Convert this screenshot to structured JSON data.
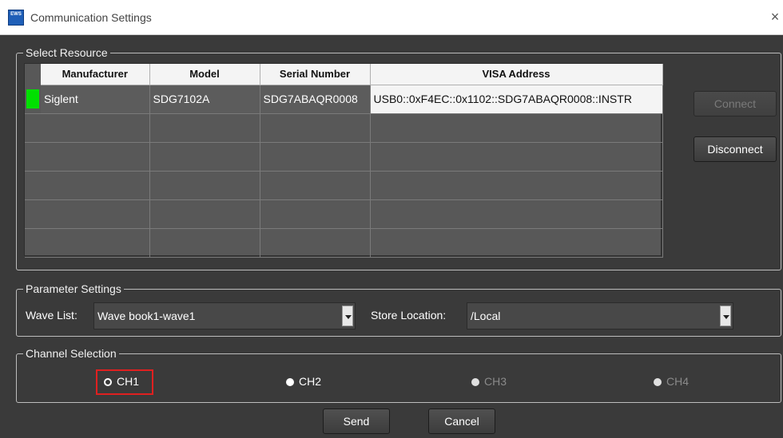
{
  "window": {
    "title": "Communication Settings",
    "app_icon_text": "EWS",
    "close_glyph": "×"
  },
  "select_resource": {
    "legend": "Select Resource",
    "columns": [
      "Manufacturer",
      "Model",
      "Serial Number",
      "VISA Address"
    ],
    "rows": [
      [
        "Siglent",
        "SDG7102A",
        "SDG7ABAQR0008",
        "USB0::0xF4EC::0x1102::SDG7ABAQR0008::INSTR"
      ],
      [
        "",
        "",
        "",
        ""
      ],
      [
        "",
        "",
        "",
        ""
      ],
      [
        "",
        "",
        "",
        ""
      ],
      [
        "",
        "",
        "",
        ""
      ],
      [
        "",
        "",
        "",
        ""
      ]
    ],
    "connect_label": "Connect",
    "disconnect_label": "Disconnect",
    "status_color": "#00e000"
  },
  "parameter_settings": {
    "legend": "Parameter Settings",
    "wave_list_label": "Wave List:",
    "wave_list_value": "Wave book1-wave1",
    "store_location_label": "Store Location:",
    "store_location_value": "/Local"
  },
  "channel_selection": {
    "legend": "Channel Selection",
    "channels": [
      {
        "label": "CH1",
        "selected": true,
        "enabled": true
      },
      {
        "label": "CH2",
        "selected": false,
        "enabled": true
      },
      {
        "label": "CH3",
        "selected": false,
        "enabled": false
      },
      {
        "label": "CH4",
        "selected": false,
        "enabled": false
      }
    ],
    "highlight_color": "#e02020"
  },
  "footer": {
    "send_label": "Send",
    "cancel_label": "Cancel"
  }
}
